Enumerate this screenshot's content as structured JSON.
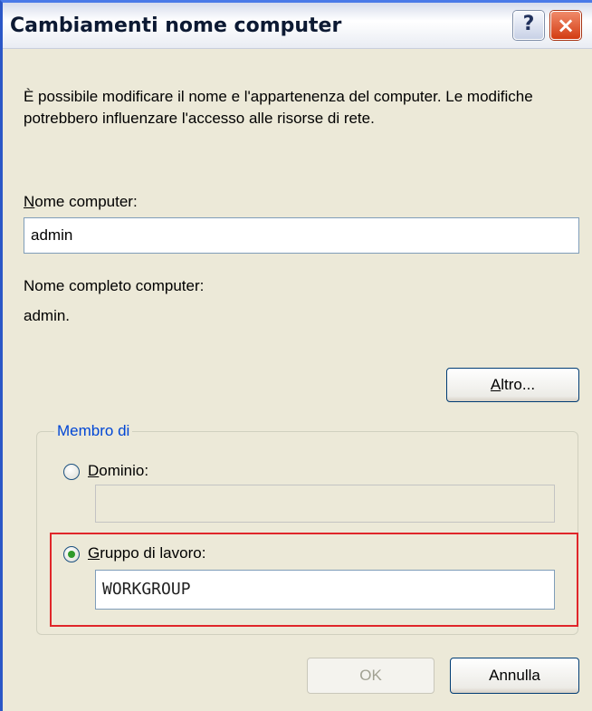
{
  "window": {
    "title": "Cambiamenti nome computer",
    "help_glyph": "?",
    "close_glyph": "×"
  },
  "description": "È possibile modificare il nome e l'appartenenza del computer. Le modifiche potrebbero influenzare l'accesso alle risorse di rete.",
  "computer_name": {
    "label_accel": "N",
    "label_rest": "ome computer:",
    "value": "admin"
  },
  "full_name": {
    "label": "Nome completo computer:",
    "value": "admin."
  },
  "more_button": {
    "accel": "A",
    "rest": "ltro..."
  },
  "member_of": {
    "legend": "Membro di",
    "domain": {
      "label_accel": "D",
      "label_rest": "ominio:",
      "selected": false,
      "value": "",
      "enabled": false
    },
    "workgroup": {
      "label_accel": "G",
      "label_rest": "ruppo di lavoro:",
      "selected": true,
      "value": "WORKGROUP"
    }
  },
  "buttons": {
    "ok": "OK",
    "cancel": "Annulla"
  },
  "colors": {
    "dialog_bg": "#ece9d8",
    "legend_blue": "#0046d5",
    "highlight_red": "#e0262a",
    "close_red": "#d33c12"
  }
}
